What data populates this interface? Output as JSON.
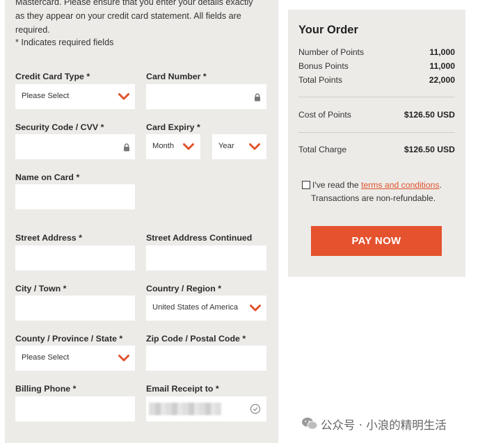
{
  "intro": {
    "line1": "Mastercard. Please ensure that you enter your details exactly",
    "line2": "as they appear on your credit card statement. All fields are",
    "line3": "required.",
    "required_note": "* Indicates required fields"
  },
  "form": {
    "card_type": {
      "label": "Credit Card Type *",
      "value": "Please Select"
    },
    "card_number": {
      "label": "Card Number *",
      "value": ""
    },
    "security_code": {
      "label": "Security Code / CVV *",
      "value": ""
    },
    "card_expiry": {
      "label": "Card Expiry *",
      "month": "Month",
      "year": "Year"
    },
    "name_on_card": {
      "label": "Name on Card *",
      "value": ""
    },
    "street_address": {
      "label": "Street Address *",
      "value": ""
    },
    "street_address_2": {
      "label": "Street Address Continued",
      "value": ""
    },
    "city": {
      "label": "City / Town *",
      "value": ""
    },
    "country": {
      "label": "Country / Region *",
      "value": "United States of America"
    },
    "state": {
      "label": "County / Province / State *",
      "value": "Please Select"
    },
    "zip": {
      "label": "Zip Code / Postal Code *",
      "value": ""
    },
    "phone": {
      "label": "Billing Phone *",
      "value": ""
    },
    "email": {
      "label": "Email Receipt to *",
      "value": ""
    }
  },
  "order": {
    "title": "Your Order",
    "rows": [
      {
        "label": "Number of Points",
        "value": "11,000"
      },
      {
        "label": "Bonus Points",
        "value": "11,000"
      },
      {
        "label": "Total Points",
        "value": "22,000"
      }
    ],
    "cost": {
      "label": "Cost of Points",
      "value": "$126.50 USD"
    },
    "total": {
      "label": "Total Charge",
      "value": "$126.50 USD"
    },
    "terms_prefix": "I've read the ",
    "terms_link": "terms and conditions",
    "terms_suffix": ".",
    "terms_line2": "Transactions are non-refundable.",
    "pay_label": "PAY NOW"
  },
  "watermark": "公众号 · 小浪的精明生活",
  "colors": {
    "accent": "#e5522e",
    "panel": "#ecebe8"
  }
}
